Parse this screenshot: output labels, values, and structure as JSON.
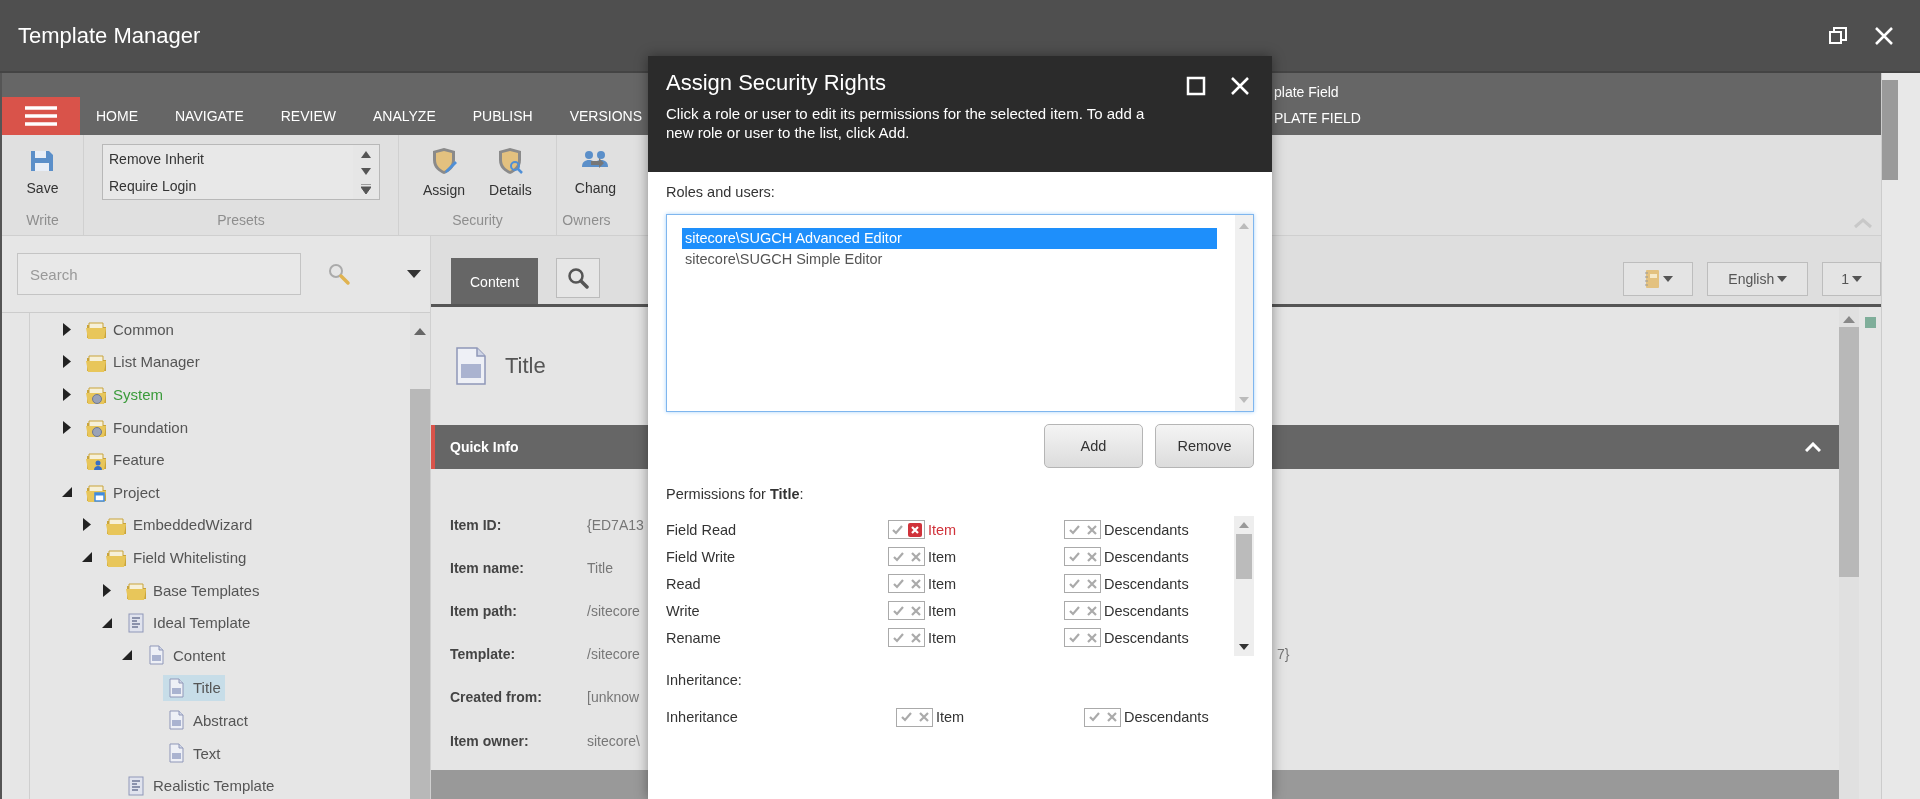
{
  "window": {
    "title": "Template Manager"
  },
  "menu_tabs": [
    {
      "label": "HOME",
      "selected": false
    },
    {
      "label": "NAVIGATE",
      "selected": false
    },
    {
      "label": "REVIEW",
      "selected": false
    },
    {
      "label": "ANALYZE",
      "selected": false
    },
    {
      "label": "PUBLISH",
      "selected": false
    },
    {
      "label": "VERSIONS",
      "selected": false
    }
  ],
  "context_tab": {
    "group": "plate Field",
    "label": "PLATE FIELD"
  },
  "ribbon": {
    "groups": [
      {
        "kind": "buttons",
        "caption": "Write",
        "buttons": [
          {
            "kind": "save",
            "label": "Save"
          }
        ]
      },
      {
        "kind": "presets",
        "caption": "Presets",
        "items": [
          "Remove Inherit",
          "Require Login"
        ]
      },
      {
        "kind": "buttons",
        "caption": "Security",
        "buttons": [
          {
            "kind": "assign",
            "label": "Assign"
          },
          {
            "kind": "details",
            "label": "Details"
          }
        ]
      },
      {
        "kind": "buttons",
        "caption": "Owners",
        "buttons": [
          {
            "kind": "change",
            "label": "Chang"
          }
        ]
      }
    ]
  },
  "search": {
    "placeholder": "Search"
  },
  "tree": [
    {
      "label": "Common",
      "kind": "folder",
      "color": "#555555",
      "expanded": false,
      "selected": false
    },
    {
      "label": "List Manager",
      "kind": "folder",
      "color": "#555555",
      "expanded": false,
      "selected": false
    },
    {
      "label": "System",
      "kind": "gear-folder",
      "color": "#3b9b3b",
      "expanded": false,
      "selected": false
    },
    {
      "label": "Foundation",
      "kind": "gear-folder",
      "color": "#555555",
      "expanded": false,
      "selected": false
    },
    {
      "label": "Feature",
      "kind": "people-folder",
      "color": "#555555",
      "selected": false
    },
    {
      "label": "Project",
      "kind": "window-folder",
      "color": "#555555",
      "expanded": true,
      "selected": false,
      "children": [
        {
          "label": "EmbeddedWizard",
          "kind": "folder",
          "color": "#555555",
          "expanded": false,
          "selected": false
        },
        {
          "label": "Field Whitelisting",
          "kind": "folder",
          "color": "#555555",
          "expanded": true,
          "selected": false,
          "children": [
            {
              "label": "Base Templates",
              "kind": "folder",
              "color": "#555555",
              "expanded": false,
              "selected": false
            },
            {
              "label": "Ideal Template",
              "kind": "template",
              "color": "#555555",
              "expanded": true,
              "selected": false,
              "children": [
                {
                  "label": "Content",
                  "kind": "section",
                  "color": "#555555",
                  "expanded": true,
                  "selected": false,
                  "children": [
                    {
                      "label": "Title",
                      "kind": "field",
                      "color": "#555555",
                      "selected": true
                    },
                    {
                      "label": "Abstract",
                      "kind": "field",
                      "color": "#555555",
                      "selected": false
                    },
                    {
                      "label": "Text",
                      "kind": "field",
                      "color": "#555555",
                      "selected": false
                    }
                  ]
                }
              ]
            },
            {
              "label": "Realistic Template",
              "kind": "template",
              "color": "#555555",
              "selected": false
            }
          ]
        }
      ]
    }
  ],
  "editor_tabs": [
    {
      "kind": "text",
      "label": "Content",
      "selected": true
    },
    {
      "kind": "search",
      "selected": false
    }
  ],
  "editor_toolbar": {
    "language": "English",
    "version": "1"
  },
  "item": {
    "title": "Title"
  },
  "quick_info": {
    "title": "Quick Info",
    "expanded": true,
    "rows": [
      {
        "label": "Item ID:",
        "value": "{ED7A13"
      },
      {
        "label": "Item name:",
        "value": "Title"
      },
      {
        "label": "Item path:",
        "value": "/sitecore"
      },
      {
        "label": "Template:",
        "value": "/sitecore",
        "tail": "7}"
      },
      {
        "label": "Created from:",
        "value": "[unknow"
      },
      {
        "label": "Item owner:",
        "value": "sitecore\\"
      }
    ]
  },
  "dialog": {
    "title": "Assign Security Rights",
    "description": "Click a role or user to edit its permissions for the selected item. To add a new role or user to the list, click Add.",
    "roles_label": "Roles and users:",
    "roles": [
      {
        "name": "sitecore\\SUGCH Advanced Editor",
        "selected": true
      },
      {
        "name": "sitecore\\SUGCH Simple Editor",
        "selected": false
      }
    ],
    "buttons": [
      "Add",
      "Remove"
    ],
    "permissions_label": "Permissions for **Title**:",
    "permissions": [
      {
        "name": "Field Read",
        "item": {
          "label": "Item",
          "denied": true
        },
        "descendants": {
          "label": "Descendants",
          "denied": false
        }
      },
      {
        "name": "Field Write",
        "item": {
          "label": "Item",
          "denied": false
        },
        "descendants": {
          "label": "Descendants",
          "denied": false
        }
      },
      {
        "name": "Read",
        "item": {
          "label": "Item",
          "denied": false
        },
        "descendants": {
          "label": "Descendants",
          "denied": false
        }
      },
      {
        "name": "Write",
        "item": {
          "label": "Item",
          "denied": false
        },
        "descendants": {
          "label": "Descendants",
          "denied": false
        }
      },
      {
        "name": "Rename",
        "item": {
          "label": "Item",
          "denied": false
        },
        "descendants": {
          "label": "Descendants",
          "denied": false
        }
      }
    ],
    "inheritance_label": "Inheritance:",
    "inheritance": {
      "name": "Inheritance",
      "item": {
        "label": "Item",
        "denied": false
      },
      "descendants": {
        "label": "Descendants",
        "denied": false
      }
    }
  }
}
